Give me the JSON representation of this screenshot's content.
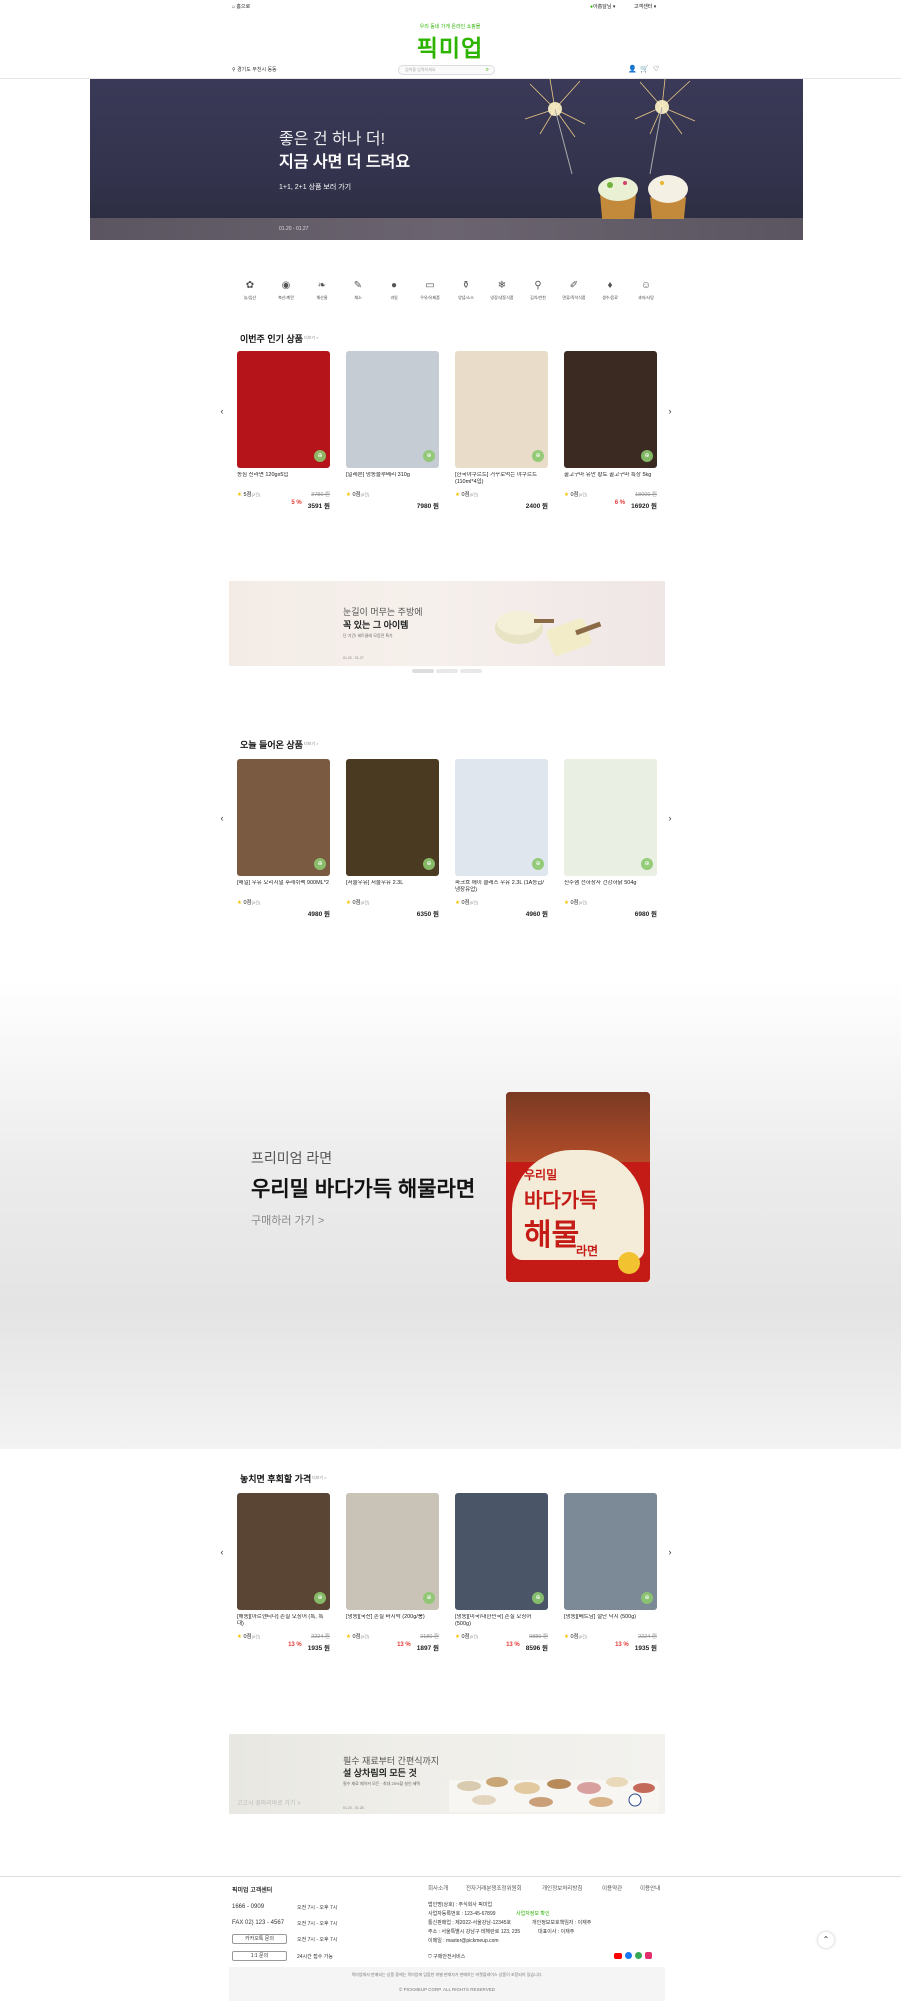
{
  "topbar": {
    "home": "홈으로",
    "user": "아홉달님",
    "support": "고객센터"
  },
  "header": {
    "slogan": "우리 동네 가게 온라인 쇼핑몰",
    "logo": "픽미업",
    "location": "경기도 부천시 동동",
    "search_placeholder": "검색을 입력하세요"
  },
  "hero": {
    "line1": "좋은 건 하나 더!",
    "line2": "지금 사면 더 드려요",
    "link": "1+1, 2+1 상품 보러 가기",
    "date": "01.20 - 01.27"
  },
  "categories": [
    "농/임산",
    "축산/계란",
    "해산물",
    "채소",
    "과일",
    "우유/유제품",
    "양념/소스",
    "냉장/냉동식품",
    "김치/반찬",
    "면류/즉석식품",
    "생수/음료",
    "과자/사탕"
  ],
  "sections": {
    "popular": {
      "title": "이번주 인기 상품",
      "more": "더보기 >",
      "items": [
        {
          "name": "농심 신라면 120gx5입",
          "rating": "5점",
          "count": "(2건)",
          "orig": "3780 원",
          "disc": "5 %",
          "price": "3591 원",
          "color": "#b5141b"
        },
        {
          "name": "[일레븐] 냉동블루베리 310g",
          "rating": "0점",
          "count": "(0건)",
          "orig": "",
          "disc": "",
          "price": "7980 원",
          "color": "#c5ccd4"
        },
        {
          "name": "[한국야쿠르트] 거꾸로먹는 야쿠르트(110ml*4입)",
          "rating": "0점",
          "count": "(0건)",
          "orig": "",
          "disc": "",
          "price": "2400 원",
          "color": "#e9dcc8"
        },
        {
          "name": "꿀고구마 유만 황토 꿀고구마 특상 5kg",
          "rating": "0점",
          "count": "(0건)",
          "orig": "18000 원",
          "disc": "6 %",
          "price": "16920 원",
          "color": "#3b2a22"
        }
      ]
    },
    "today": {
      "title": "오늘 들어온 상품",
      "more": "더보기 >",
      "items": [
        {
          "name": "[매일] 우유 오리지널 후레쉬팩 900ML*2",
          "rating": "0점",
          "count": "(0건)",
          "orig": "",
          "disc": "",
          "price": "4980 원",
          "color": "#7a5a40"
        },
        {
          "name": "[서울우유] 서울우유 2.3L",
          "rating": "0점",
          "count": "(0건)",
          "orig": "",
          "disc": "",
          "price": "6350 원",
          "color": "#4b3a22"
        },
        {
          "name": "파크흐 에이 클래스 우유 2.3L (1A등급/냉장유업)",
          "rating": "0점",
          "count": "(0건)",
          "orig": "",
          "disc": "",
          "price": "4960 원",
          "color": "#dfe6ee"
        },
        {
          "name": "진주햄 천하장사 건강하닭 504g",
          "rating": "0점",
          "count": "(0건)",
          "orig": "",
          "disc": "",
          "price": "6980 원",
          "color": "#e9efe3"
        }
      ]
    },
    "miss": {
      "title": "놓치면 후회할 가격",
      "more": "더보기 >",
      "items": [
        {
          "name": "[해동][아르헨티나] 손질 오징어 (특, 특대)",
          "rating": "0점",
          "count": "(0건)",
          "orig": "2224 원",
          "disc": "13 %",
          "price": "1935 원",
          "color": "#5a4433"
        },
        {
          "name": "[냉동][국산] 손질 바지락 (200g/봉)",
          "rating": "0점",
          "count": "(0건)",
          "orig": "2180 원",
          "disc": "13 %",
          "price": "1897 원",
          "color": "#c9c2b6"
        },
        {
          "name": "[냉동][미국/대한민국] 손질 오징어 (500g)",
          "rating": "0점",
          "count": "(0건)",
          "orig": "9880 원",
          "disc": "13 %",
          "price": "8596 원",
          "color": "#4a5568"
        },
        {
          "name": "[냉동][베트남] 절단 낙지 (500g)",
          "rating": "0점",
          "count": "(0건)",
          "orig": "2224 원",
          "disc": "13 %",
          "price": "1935 원",
          "color": "#7b8a96"
        }
      ]
    }
  },
  "banner1": {
    "line1": "눈길이 머무는 주방에",
    "line2": "꼭 있는 그 아이템",
    "sub": "단 기간! 세트클래 모음전 특가",
    "date": "01.20 - 01.27"
  },
  "promo": {
    "small": "프리미엄 라면",
    "big": "우리밀 바다가득 해물라면",
    "link": "구매하러 가기 >",
    "pack1": "우리밀",
    "pack2": "바다가득",
    "pack3": "해물",
    "pack4": "라면"
  },
  "banner2": {
    "line1": "필수 재료부터 간편식까지",
    "line2": "설 상차림의 모든 것",
    "sub": "필수 재료 메이커 모든 · 최대 25%할 설인 혜택",
    "date": "01.20 - 01.28",
    "watermark": "고고시 꽃마리바로 가기 >"
  },
  "footer": {
    "cs_title": "픽미업 고객센터",
    "phone": "1666 - 0909",
    "fax": "FAX 02) 123 - 4567",
    "kakao": "카카오톡 문의",
    "qna": "1:1 문의",
    "hours": [
      "오전 7시 - 오후 7시",
      "오전 7시 - 오후 7시",
      "오전 7시 - 오후 7시",
      "24시간 접수 가능"
    ],
    "nav": [
      "회사소개",
      "전자거래분쟁조정위원회",
      "개인정보처리방침",
      "이용약관",
      "이용안내"
    ],
    "info": [
      "법인명(상호) : 주식회사 픽미업",
      "사업자등록번호 : 123-45-67899",
      "통신판매업 : 제2022-서울강남-12345호",
      "주소 : 서울특별시 강남구 테헤란로 123, 235",
      "이메일 : master@pickmeup.com"
    ],
    "info_link": "사업자정보 확인",
    "officer": "개인정보보호책임자 : 이재주",
    "ceo": "대표이사 : 이재주",
    "secure": "구매안전서비스",
    "notice": "픽미업에서 판매되는 상품 중에는 픽미업에 입점한 개별 판매자가 판매하는 마켓플레이스 상품이 포함되어 있습니다.",
    "copyright": "© PICKMEUP CORP. ALL RIGHTS RESERVED"
  },
  "colors": {
    "brand": "#2db400",
    "discount": "#e53935",
    "star": "#f5c200"
  }
}
